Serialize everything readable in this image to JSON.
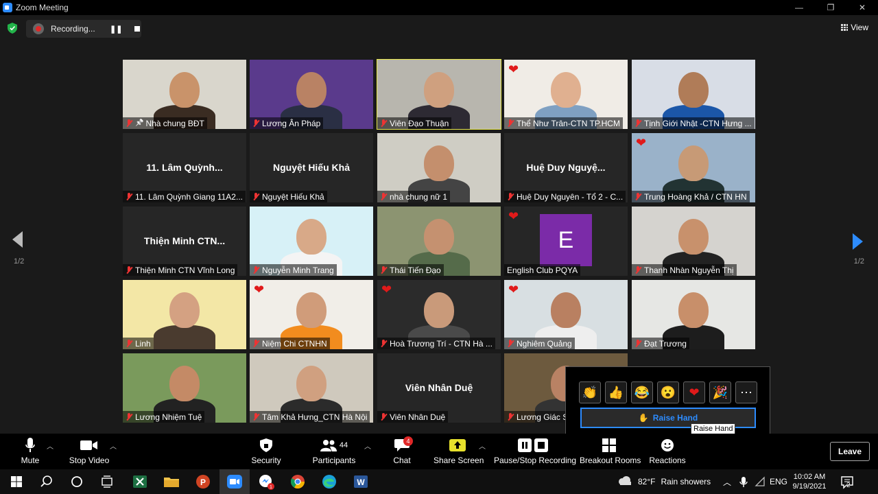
{
  "window": {
    "title": "Zoom Meeting",
    "controls": [
      "—",
      "❐",
      "✕"
    ]
  },
  "meeting": {
    "recording_label": "Recording...",
    "view_label": "View",
    "page_indicator_left": "1/2",
    "page_indicator_right": "1/2"
  },
  "tiles": [
    {
      "name": "Nhà chung BĐT",
      "type": "video",
      "pinned": true
    },
    {
      "name": "Lương Ân Pháp",
      "type": "video"
    },
    {
      "name": "Viên Đạo Thuận",
      "type": "video",
      "active_speaker": true
    },
    {
      "name": "Thể Như Trân-CTN TP.HCM",
      "type": "video",
      "reaction": "heart"
    },
    {
      "name": "Tịnh Giới Nhật -CTN Hưng ...",
      "type": "video"
    },
    {
      "name": "11. Lâm Quỳnh Giang 11A2...",
      "display_name": "11. Lâm Quỳnh...",
      "type": "name"
    },
    {
      "name": "Nguyệt Hiếu Khả",
      "display_name": "Nguyệt Hiếu Khả",
      "type": "name"
    },
    {
      "name": "nhà chung nữ 1",
      "type": "video"
    },
    {
      "name": "Huệ Duy Nguyên - Tổ 2 - C...",
      "display_name": "Huệ Duy Nguyệ...",
      "type": "name"
    },
    {
      "name": "Trung Hoàng Khả / CTN HN",
      "type": "video",
      "reaction": "heart"
    },
    {
      "name": "Thiện Minh CTN Vĩnh Long",
      "display_name": "Thiện Minh CTN...",
      "type": "name"
    },
    {
      "name": "Nguyễn Minh Trang",
      "type": "video"
    },
    {
      "name": "Thái Tiến Đạo",
      "type": "video"
    },
    {
      "name": "English Club PQYA",
      "type": "avatar",
      "avatar_letter": "E",
      "reaction": "heart"
    },
    {
      "name": "Thanh Nhàn Nguyễn Thị",
      "type": "video"
    },
    {
      "name": "Linh",
      "type": "video"
    },
    {
      "name": "Niệm Chi CTNHN",
      "type": "video",
      "reaction": "heart"
    },
    {
      "name": "Hoà Trương Trí - CTN Hà ...",
      "type": "video",
      "reaction": "heart"
    },
    {
      "name": "Nghiêm Quảng",
      "type": "video",
      "reaction": "heart"
    },
    {
      "name": "Đạt Trương",
      "type": "video"
    },
    {
      "name": "Lương Nhiệm Tuệ",
      "type": "video"
    },
    {
      "name": "Tâm Khả Hưng_CTN Hà Nội",
      "type": "video"
    },
    {
      "name": "Viên Nhân Duệ",
      "display_name": "Viên Nhân Duệ",
      "type": "name"
    },
    {
      "name": "Lương Giác S",
      "type": "video"
    }
  ],
  "reactions_panel": {
    "emojis": [
      "👏",
      "👍",
      "😂",
      "😮",
      "❤",
      "🎉",
      "⋯"
    ],
    "raise_hand_label": "Raise Hand",
    "tooltip": "Raise Hand"
  },
  "toolbar": {
    "mute": "Mute",
    "stop_video": "Stop Video",
    "security": "Security",
    "participants": "Participants",
    "participants_count": "44",
    "chat": "Chat",
    "chat_badge": "4",
    "share_screen": "Share Screen",
    "pause_recording": "Pause/Stop Recording",
    "breakout_rooms": "Breakout Rooms",
    "reactions": "Reactions",
    "leave": "Leave"
  },
  "taskbar": {
    "weather": "82°F",
    "weather_desc": "Rain showers",
    "lang": "ENG",
    "time": "10:02 AM",
    "date": "9/19/2021",
    "notif_count": "2"
  },
  "colors": {
    "accent": "#2d8cff",
    "active_border": "#e8e84c",
    "heart": "#e01a1a",
    "avatar": "#7b2ba8"
  }
}
